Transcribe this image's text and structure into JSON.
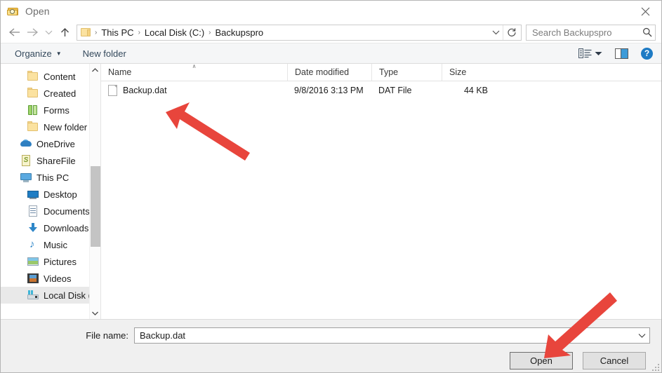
{
  "window": {
    "title": "Open",
    "icon": "open-folder-search-icon",
    "close_label": "✕"
  },
  "addressbar": {
    "back_icon": "back-arrow-icon",
    "forward_icon": "forward-arrow-icon",
    "recent_icon": "chevron-down-icon",
    "up_icon": "up-arrow-icon",
    "folder_icon": "folder-icon",
    "breadcrumbs": [
      "This PC",
      "Local Disk (C:)",
      "Backupspro"
    ],
    "separator": "›",
    "dropdown_icon": "chevron-down-icon",
    "refresh_icon": "refresh-icon"
  },
  "search": {
    "placeholder": "Search Backupspro",
    "icon": "search-icon"
  },
  "toolbar": {
    "organize_label": "Organize",
    "organize_caret": "▼",
    "new_folder_label": "New folder",
    "view_icon": "view-layout-icon",
    "view_caret": "▼",
    "preview_pane_icon": "preview-pane-icon",
    "help_icon": "help-icon",
    "help_label": "?"
  },
  "navpane": {
    "items": [
      {
        "label": "Content",
        "icon": "folder-icon",
        "indent": 1,
        "selected": false
      },
      {
        "label": "Created",
        "icon": "folder-icon",
        "indent": 1,
        "selected": false
      },
      {
        "label": "Forms",
        "icon": "forms-folder-icon",
        "indent": 1,
        "selected": false
      },
      {
        "label": "New folder",
        "icon": "folder-icon",
        "indent": 1,
        "selected": false
      },
      {
        "label": "OneDrive",
        "icon": "onedrive-cloud-icon",
        "indent": 0,
        "selected": false
      },
      {
        "label": "ShareFile",
        "icon": "sharefile-icon",
        "indent": 0,
        "selected": false
      },
      {
        "label": "This PC",
        "icon": "this-pc-icon",
        "indent": 0,
        "selected": false
      },
      {
        "label": "Desktop",
        "icon": "desktop-icon",
        "indent": 1,
        "selected": false
      },
      {
        "label": "Documents",
        "icon": "documents-icon",
        "indent": 1,
        "selected": false
      },
      {
        "label": "Downloads",
        "icon": "downloads-icon",
        "indent": 1,
        "selected": false
      },
      {
        "label": "Music",
        "icon": "music-icon",
        "indent": 1,
        "selected": false
      },
      {
        "label": "Pictures",
        "icon": "pictures-icon",
        "indent": 1,
        "selected": false
      },
      {
        "label": "Videos",
        "icon": "videos-icon",
        "indent": 1,
        "selected": false
      },
      {
        "label": "Local Disk (C:)",
        "icon": "drive-icon",
        "indent": 1,
        "selected": true
      }
    ],
    "scroll_up_icon": "chevron-up-icon",
    "scroll_down_icon": "chevron-down-icon"
  },
  "filelist": {
    "columns": [
      {
        "label": "Name",
        "sorted": "ascending"
      },
      {
        "label": "Date modified",
        "sorted": ""
      },
      {
        "label": "Type",
        "sorted": ""
      },
      {
        "label": "Size",
        "sorted": ""
      }
    ],
    "sort_caret": "∧",
    "rows": [
      {
        "name": "Backup.dat",
        "icon": "dat-file-icon",
        "date_modified": "9/8/2016 3:13 PM",
        "type": "DAT File",
        "size": "44 KB"
      }
    ]
  },
  "footer": {
    "filename_label": "File name:",
    "filename_value": "Backup.dat",
    "filename_dropdown_icon": "chevron-down-icon",
    "open_label": "Open",
    "cancel_label": "Cancel",
    "resize_grip_icon": "resize-grip-icon"
  },
  "annotations": {
    "color": "#E8453C",
    "arrows": [
      {
        "name": "arrow-pointing-to-file",
        "target": "Backup.dat",
        "direction": "up-left"
      },
      {
        "name": "arrow-pointing-to-open-button",
        "target": "Open",
        "direction": "down-left"
      }
    ]
  }
}
